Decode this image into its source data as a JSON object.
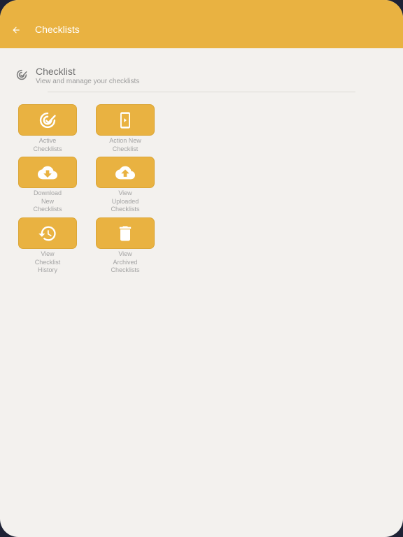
{
  "app_bar": {
    "title": "Checklists",
    "back_icon": "arrow-left-icon",
    "color": "#e9b241"
  },
  "section": {
    "title": "Checklist",
    "subtitle": "View and manage your checklists",
    "icon": "checklist-check-icon"
  },
  "tiles": [
    {
      "label": "Active\nChecklists",
      "icon": "checklist-check-icon"
    },
    {
      "label": "Action New\nChecklist",
      "icon": "phone-play-icon"
    },
    {
      "label": "Download\nNew\nChecklists",
      "icon": "cloud-download-icon"
    },
    {
      "label": "View\nUploaded\nChecklists",
      "icon": "cloud-upload-icon"
    },
    {
      "label": "View\nChecklist\nHistory",
      "icon": "history-icon"
    },
    {
      "label": "View\nArchived\nChecklists",
      "icon": "trash-icon"
    }
  ],
  "colors": {
    "accent": "#e9b241",
    "background": "#f3f1ee",
    "frame": "#1e2235"
  }
}
